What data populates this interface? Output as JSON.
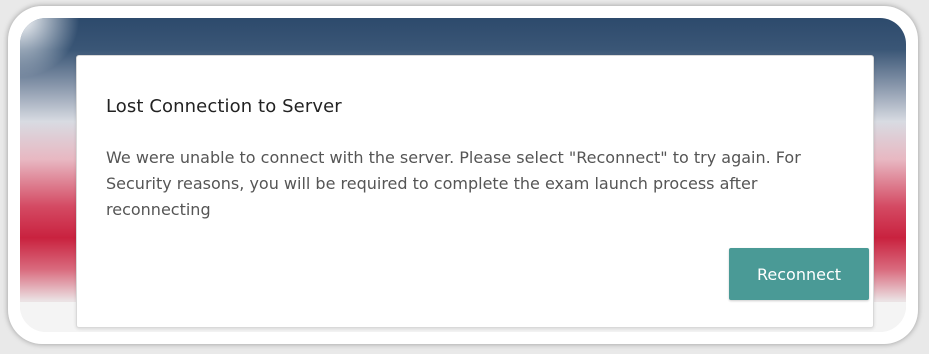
{
  "dialog": {
    "title": "Lost Connection to Server",
    "message": "We were unable to connect with the server. Please select \"Reconnect\" to try again. For Security reasons, you will be required to complete the exam launch process after reconnecting",
    "reconnect_label": "Reconnect"
  },
  "colors": {
    "button": "#4a9a96",
    "banner_top": "#2d4a6c",
    "banner_red": "#c9223f"
  }
}
